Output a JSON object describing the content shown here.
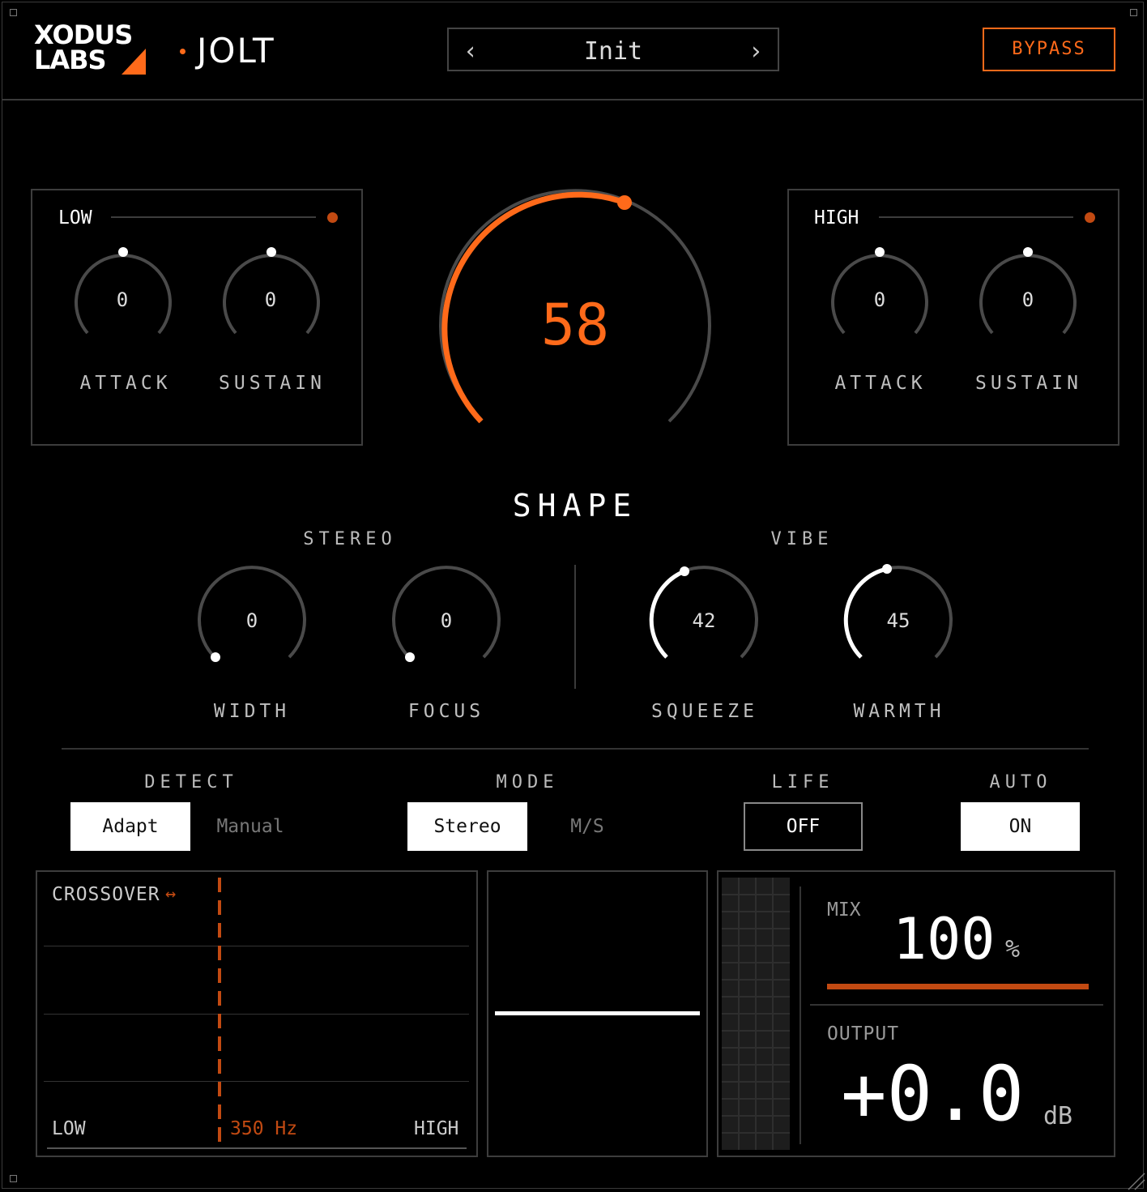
{
  "brand": {
    "logo_line1": "XODUS",
    "logo_line2": "LABS",
    "product": "JOLT"
  },
  "preset": {
    "name": "Init",
    "prev_symbol": "‹",
    "next_symbol": "›"
  },
  "bypass_label": "BYPASS",
  "low_band": {
    "title": "LOW",
    "attack": {
      "label": "ATTACK",
      "value": "0"
    },
    "sustain": {
      "label": "SUSTAIN",
      "value": "0"
    }
  },
  "high_band": {
    "title": "HIGH",
    "attack": {
      "label": "ATTACK",
      "value": "0"
    },
    "sustain": {
      "label": "SUSTAIN",
      "value": "0"
    }
  },
  "shape": {
    "label": "SHAPE",
    "value": "58"
  },
  "stereo": {
    "title": "STEREO",
    "width": {
      "label": "WIDTH",
      "value": "0"
    },
    "focus": {
      "label": "FOCUS",
      "value": "0"
    }
  },
  "vibe": {
    "title": "VIBE",
    "squeeze": {
      "label": "SQUEEZE",
      "value": "42"
    },
    "warmth": {
      "label": "WARMTH",
      "value": "45"
    }
  },
  "detect": {
    "title": "DETECT",
    "options": [
      "Adapt",
      "Manual"
    ],
    "selected": "Adapt"
  },
  "mode": {
    "title": "MODE",
    "options": [
      "Stereo",
      "M/S"
    ],
    "selected": "Stereo"
  },
  "life": {
    "title": "LIFE",
    "state": "OFF"
  },
  "auto": {
    "title": "AUTO",
    "state": "ON"
  },
  "crossover": {
    "label": "CROSSOVER",
    "icon": "↔",
    "low_label": "LOW",
    "high_label": "HIGH",
    "freq": "350 Hz"
  },
  "mix": {
    "label": "MIX",
    "value": "100",
    "unit": "%"
  },
  "output": {
    "label": "OUTPUT",
    "value": "+0.0",
    "unit": "dB"
  },
  "colors": {
    "accent": "#ff6a1a",
    "accent_dark": "#c24a12",
    "background": "#000000",
    "border": "#3d3d3d"
  }
}
